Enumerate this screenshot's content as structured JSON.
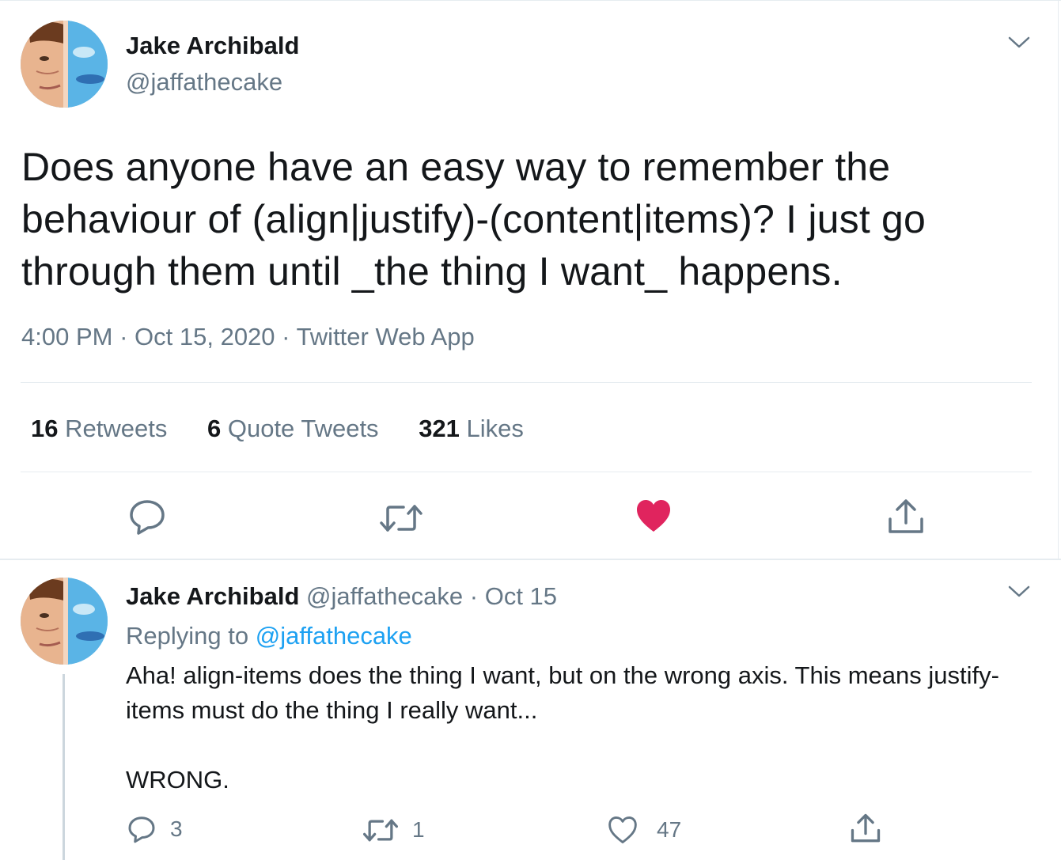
{
  "tweet": {
    "author_name": "Jake Archibald",
    "author_handle": "@jaffathecake",
    "text": "Does anyone have an easy way to remember the behaviour of (align|justify)-(content|items)? I just go through them until _the thing I want_ happens.",
    "time": "4:00 PM",
    "date": "Oct 15, 2020",
    "source": "Twitter Web App",
    "separator": "·",
    "stats": {
      "retweets_count": "16",
      "retweets_label": "Retweets",
      "quotes_count": "6",
      "quotes_label": "Quote Tweets",
      "likes_count": "321",
      "likes_label": "Likes"
    },
    "liked": true,
    "like_color": "#e0245e"
  },
  "reply": {
    "author_name": "Jake Archibald",
    "author_handle": "@jaffathecake",
    "separator": "·",
    "date": "Oct 15",
    "replying_prefix": "Replying to",
    "replying_to": "@jaffathecake",
    "text": "Aha! align-items does the thing I want, but on the wrong axis. This means justify-items must do the thing I really want...\n\nWRONG.",
    "reply_count": "3",
    "retweet_count": "1",
    "like_count": "47"
  },
  "icons": [
    "chevron-down-icon",
    "reply-icon",
    "retweet-icon",
    "heart-icon",
    "share-icon"
  ],
  "colors": {
    "link": "#1da1f2",
    "muted": "#657786",
    "text": "#14171a",
    "like": "#e0245e"
  }
}
